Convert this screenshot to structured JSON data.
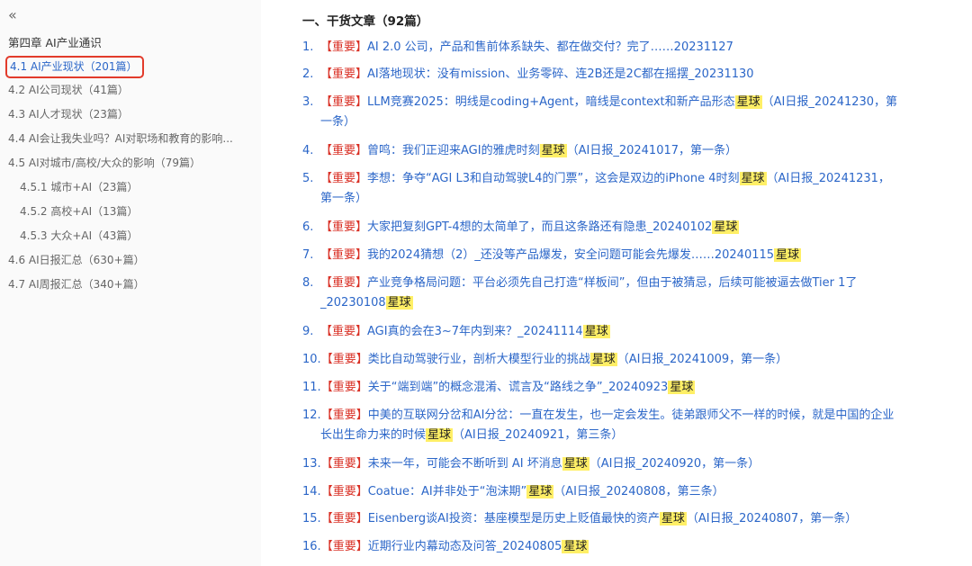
{
  "sidebar": {
    "collapse_glyph": "«",
    "chapter_title": "第四章 AI产业通识",
    "items": [
      {
        "label": "4.1 AI产业现状（201篇）",
        "active": true,
        "indent": 0
      },
      {
        "label": "4.2 AI公司现状（41篇）",
        "active": false,
        "indent": 0
      },
      {
        "label": "4.3 AI人才现状（23篇）",
        "active": false,
        "indent": 0
      },
      {
        "label": "4.4 AI会让我失业吗？AI对职场和教育的影响...",
        "active": false,
        "indent": 0
      },
      {
        "label": "4.5 AI对城市/高校/大众的影响（79篇）",
        "active": false,
        "indent": 0
      },
      {
        "label": "4.5.1 城市+AI（23篇）",
        "active": false,
        "indent": 1
      },
      {
        "label": "4.5.2 高校+AI（13篇）",
        "active": false,
        "indent": 1
      },
      {
        "label": "4.5.3 大众+AI（43篇）",
        "active": false,
        "indent": 1
      },
      {
        "label": "4.6 AI日报汇总（630+篇）",
        "active": false,
        "indent": 0
      },
      {
        "label": "4.7 AI周报汇总（340+篇）",
        "active": false,
        "indent": 0
      }
    ]
  },
  "main": {
    "section_title": "一、干货文章（92篇）",
    "articles": [
      {
        "num": "1.",
        "tag": "【重要】",
        "title": "AI 2.0 公司，产品和售前体系缺失、都在做交付？完了……20231127",
        "star": "",
        "tail": ""
      },
      {
        "num": "2.",
        "tag": "【重要】",
        "title": "AI落地现状：没有mission、业务零碎、连2B还是2C都在摇摆_20231130",
        "star": "",
        "tail": ""
      },
      {
        "num": "3.",
        "tag": "【重要】",
        "title": "LLM竞赛2025：明线是coding+Agent，暗线是context和新产品形态",
        "star": "星球",
        "tail": "（AI日报_20241230，第",
        "tail2": "一条）"
      },
      {
        "num": "4.",
        "tag": "【重要】",
        "title": "曾鸣：我们正迎来AGI的雅虎时刻",
        "star": "星球",
        "tail": "（AI日报_20241017，第一条）"
      },
      {
        "num": "5.",
        "tag": "【重要】",
        "title": "李想：争夺“AGI L3和自动驾驶L4的门票”，这会是双边的iPhone 4时刻",
        "star": "星球",
        "tail": "（AI日报_20241231，",
        "tail2": "第一条）"
      },
      {
        "num": "6.",
        "tag": "【重要】",
        "title": "大家把复刻GPT-4想的太简单了，而且这条路还有隐患_20240102",
        "star": "星球",
        "tail": ""
      },
      {
        "num": "7.",
        "tag": "【重要】",
        "title": "我的2024猜想（2）_还没等产品爆发，安全问题可能会先爆发……20240115",
        "star": "星球",
        "tail": ""
      },
      {
        "num": "8.",
        "tag": "【重要】",
        "title": "产业竞争格局问题：平台必须先自己打造“样板间”，但由于被猜忌，后续可能被逼去做Tier 1了",
        "title2": "_20230108",
        "star": "星球",
        "tail": ""
      },
      {
        "num": "9.",
        "tag": "【重要】",
        "title": "AGI真的会在3~7年内到来？_20241114",
        "star": "星球",
        "tail": ""
      },
      {
        "num": "10.",
        "tag": "【重要】",
        "title": "类比自动驾驶行业，剖析大模型行业的挑战",
        "star": "星球",
        "tail": "（AI日报_20241009，第一条）"
      },
      {
        "num": "11.",
        "tag": "【重要】",
        "title": "关于“端到端”的概念混淆、谎言及“路线之争”_20240923",
        "star": "星球",
        "tail": ""
      },
      {
        "num": "12.",
        "tag": "【重要】",
        "title": "中美的互联网分岔和AI分岔：一直在发生，也一定会发生。徒弟跟师父不一样的时候，就是中国的企业",
        "title2": "长出生命力来的时候",
        "star": "星球",
        "tail": "（AI日报_20240921，第三条）"
      },
      {
        "num": "13.",
        "tag": "【重要】",
        "title": "未来一年，可能会不断听到 AI 坏消息",
        "star": "星球",
        "tail": "（AI日报_20240920，第一条）"
      },
      {
        "num": "14.",
        "tag": "【重要】",
        "title": "Coatue：AI并非处于“泡沫期”",
        "star": "星球",
        "tail": "（AI日报_20240808，第三条）"
      },
      {
        "num": "15.",
        "tag": "【重要】",
        "title": "Eisenberg谈AI投资：基座模型是历史上贬值最快的资产",
        "star": "星球",
        "tail": "（AI日报_20240807，第一条）"
      },
      {
        "num": "16.",
        "tag": "【重要】",
        "title": "近期行业内幕动态及问答_20240805",
        "star": "星球",
        "tail": ""
      }
    ]
  },
  "colors": {
    "link": "#2b66c8",
    "important": "#d93025",
    "highlight": "#ffef66",
    "active_border": "#e23b2b"
  }
}
